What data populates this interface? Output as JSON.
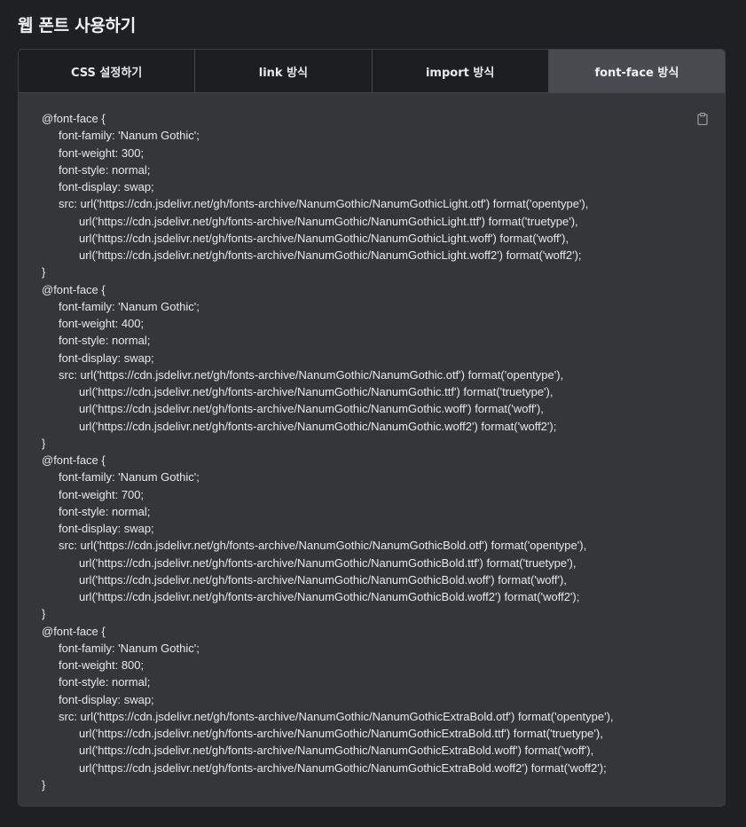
{
  "page": {
    "title": "웹 폰트 사용하기"
  },
  "tabs": [
    {
      "label": "CSS 설정하기",
      "active": false
    },
    {
      "label": "link 방식",
      "active": false
    },
    {
      "label": "import 방식",
      "active": false
    },
    {
      "label": "font-face 방식",
      "active": true
    }
  ],
  "code": {
    "copy_icon": "clipboard-icon",
    "lines": [
      "@font-face {",
      "font-family: 'Nanum Gothic';",
      "font-weight: 300;",
      "font-style: normal;",
      "font-display: swap;",
      "src: url('https://cdn.jsdelivr.net/gh/fonts-archive/NanumGothic/NanumGothicLight.otf') format('opentype'),",
      "url('https://cdn.jsdelivr.net/gh/fonts-archive/NanumGothic/NanumGothicLight.ttf') format('truetype'),",
      "url('https://cdn.jsdelivr.net/gh/fonts-archive/NanumGothic/NanumGothicLight.woff') format('woff'),",
      "url('https://cdn.jsdelivr.net/gh/fonts-archive/NanumGothic/NanumGothicLight.woff2') format('woff2');",
      "}",
      "@font-face {",
      "font-family: 'Nanum Gothic';",
      "font-weight: 400;",
      "font-style: normal;",
      "font-display: swap;",
      "src: url('https://cdn.jsdelivr.net/gh/fonts-archive/NanumGothic/NanumGothic.otf') format('opentype'),",
      "url('https://cdn.jsdelivr.net/gh/fonts-archive/NanumGothic/NanumGothic.ttf') format('truetype'),",
      "url('https://cdn.jsdelivr.net/gh/fonts-archive/NanumGothic/NanumGothic.woff') format('woff'),",
      "url('https://cdn.jsdelivr.net/gh/fonts-archive/NanumGothic/NanumGothic.woff2') format('woff2');",
      "}",
      "@font-face {",
      "font-family: 'Nanum Gothic';",
      "font-weight: 700;",
      "font-style: normal;",
      "font-display: swap;",
      "src: url('https://cdn.jsdelivr.net/gh/fonts-archive/NanumGothic/NanumGothicBold.otf') format('opentype'),",
      "url('https://cdn.jsdelivr.net/gh/fonts-archive/NanumGothic/NanumGothicBold.ttf') format('truetype'),",
      "url('https://cdn.jsdelivr.net/gh/fonts-archive/NanumGothic/NanumGothicBold.woff') format('woff'),",
      "url('https://cdn.jsdelivr.net/gh/fonts-archive/NanumGothic/NanumGothicBold.woff2') format('woff2');",
      "}",
      "@font-face {",
      "font-family: 'Nanum Gothic';",
      "font-weight: 800;",
      "font-style: normal;",
      "font-display: swap;",
      "src: url('https://cdn.jsdelivr.net/gh/fonts-archive/NanumGothic/NanumGothicExtraBold.otf') format('opentype'),",
      "url('https://cdn.jsdelivr.net/gh/fonts-archive/NanumGothic/NanumGothicExtraBold.ttf') format('truetype'),",
      "url('https://cdn.jsdelivr.net/gh/fonts-archive/NanumGothic/NanumGothicExtraBold.woff') format('woff'),",
      "url('https://cdn.jsdelivr.net/gh/fonts-archive/NanumGothic/NanumGothicExtraBold.woff2') format('woff2');",
      "}"
    ]
  }
}
